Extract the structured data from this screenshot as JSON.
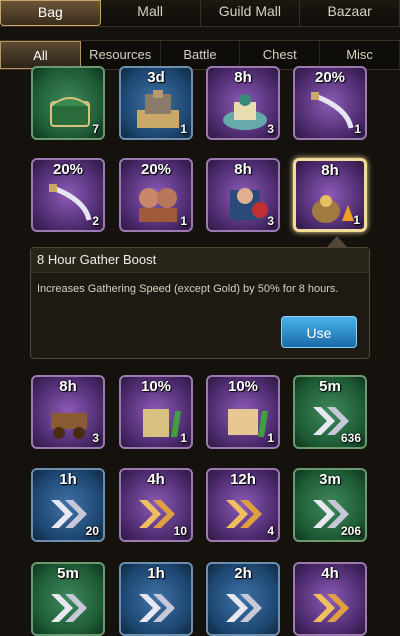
{
  "top_tabs": [
    "Bag",
    "Mall",
    "Guild Mall",
    "Bazaar"
  ],
  "sub_tabs": [
    "All",
    "Resources",
    "Battle",
    "Chest",
    "Misc"
  ],
  "items_row1": [
    {
      "tag": "",
      "count": "7",
      "color": "green",
      "icon": "chest-icon"
    },
    {
      "tag": "3d",
      "count": "1",
      "color": "blue",
      "icon": "city-map-icon"
    },
    {
      "tag": "8h",
      "count": "3",
      "color": "purple",
      "icon": "palace-icon"
    },
    {
      "tag": "20%",
      "count": "1",
      "color": "purple",
      "icon": "sword-icon"
    }
  ],
  "items_row2": [
    {
      "tag": "20%",
      "count": "2",
      "color": "purple",
      "icon": "sword-icon"
    },
    {
      "tag": "20%",
      "count": "1",
      "color": "purple",
      "icon": "soldiers-icon"
    },
    {
      "tag": "8h",
      "count": "3",
      "color": "purple",
      "icon": "army-icon"
    },
    {
      "tag": "8h",
      "count": "1",
      "color": "purple",
      "icon": "gather-boost-icon"
    }
  ],
  "detail": {
    "title": "8 Hour Gather Boost",
    "description": "Increases Gathering Speed (except Gold) by 50% for 8 hours.",
    "use_label": "Use"
  },
  "items_row3": [
    {
      "tag": "8h",
      "count": "3",
      "color": "purple",
      "icon": "cart-icon"
    },
    {
      "tag": "10%",
      "count": "1",
      "color": "purple",
      "icon": "building-boost-icon"
    },
    {
      "tag": "10%",
      "count": "1",
      "color": "purple",
      "icon": "scroll-boost-icon"
    },
    {
      "tag": "5m",
      "count": "636",
      "color": "green",
      "icon": "speedup-icon"
    }
  ],
  "items_row4": [
    {
      "tag": "1h",
      "count": "20",
      "color": "blue",
      "icon": "speedup-icon"
    },
    {
      "tag": "4h",
      "count": "10",
      "color": "purple",
      "icon": "speedup-gold-icon"
    },
    {
      "tag": "12h",
      "count": "4",
      "color": "purple",
      "icon": "speedup-gold-icon"
    },
    {
      "tag": "3m",
      "count": "206",
      "color": "green",
      "icon": "speedup-icon"
    }
  ],
  "items_row5": [
    {
      "tag": "5m",
      "count": "",
      "color": "green",
      "icon": "speedup-icon"
    },
    {
      "tag": "1h",
      "count": "",
      "color": "blue",
      "icon": "speedup-icon"
    },
    {
      "tag": "2h",
      "count": "",
      "color": "blue",
      "icon": "speedup-icon"
    },
    {
      "tag": "4h",
      "count": "",
      "color": "purple",
      "icon": "speedup-gold-icon"
    }
  ]
}
